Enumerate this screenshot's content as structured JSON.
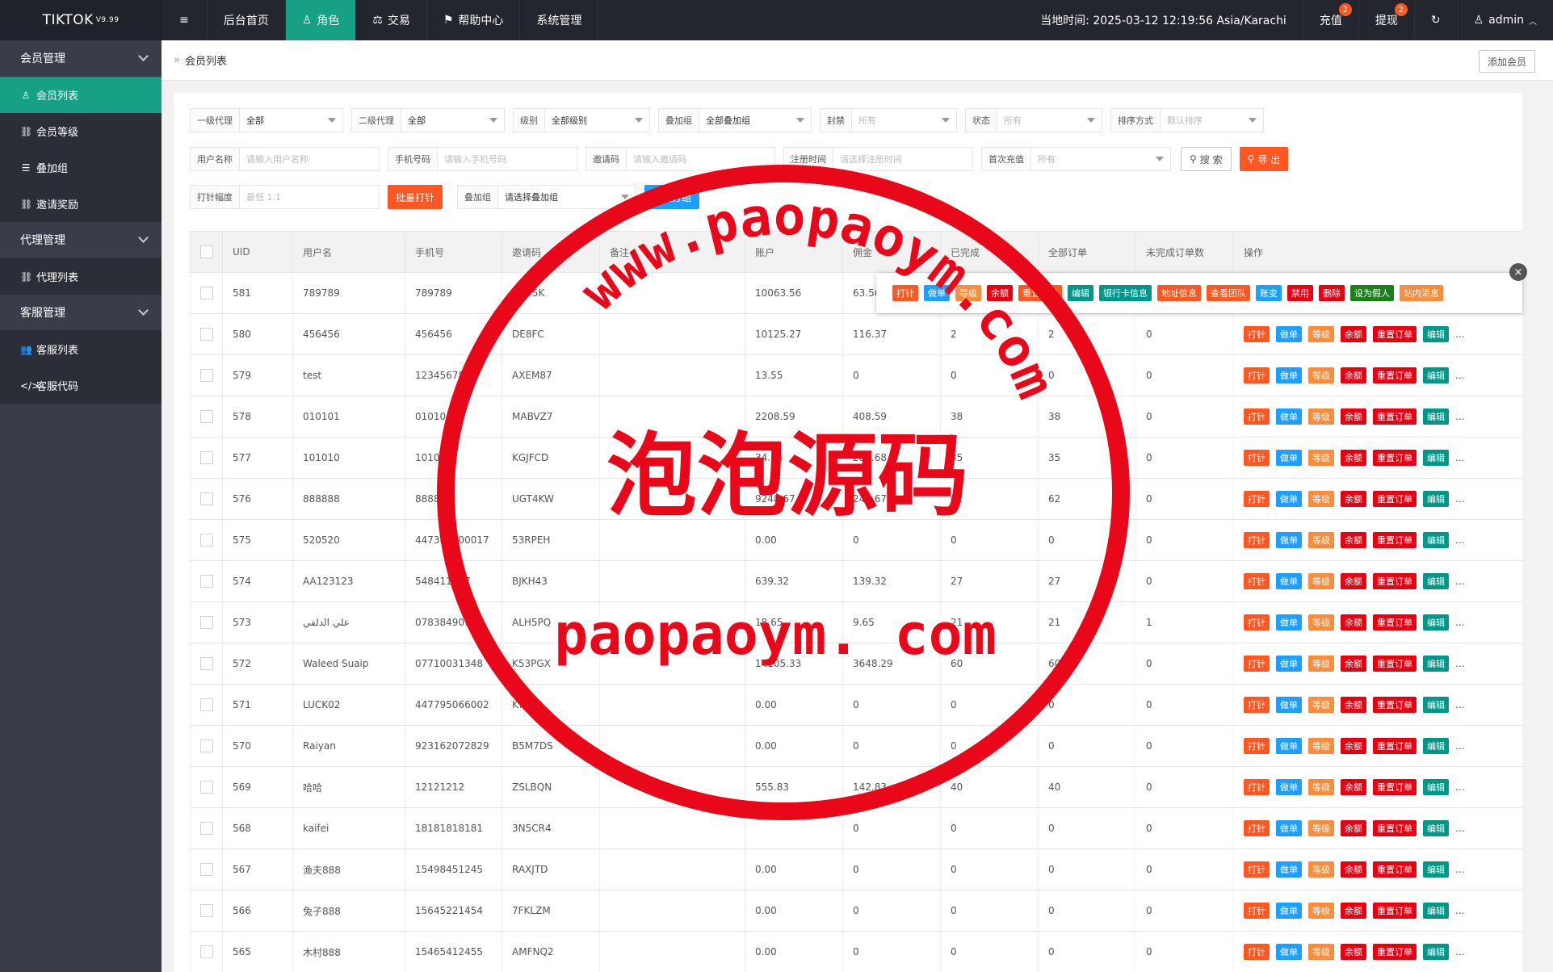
{
  "app": {
    "title": "TIKTOK",
    "version": "V9.99"
  },
  "sidebar": {
    "groups": [
      {
        "label": "会员管理",
        "items": [
          {
            "label": "会员列表",
            "icon": "user-icon",
            "active": true
          },
          {
            "label": "会员等级",
            "icon": "link-icon"
          },
          {
            "label": "叠加组",
            "icon": "list-icon"
          },
          {
            "label": "邀请奖励",
            "icon": "link-icon"
          }
        ]
      },
      {
        "label": "代理管理",
        "items": [
          {
            "label": "代理列表",
            "icon": "link-icon"
          }
        ]
      },
      {
        "label": "客服管理",
        "items": [
          {
            "label": "客服列表",
            "icon": "users-icon"
          },
          {
            "label": "客服代码",
            "icon": "code-icon"
          }
        ]
      }
    ]
  },
  "topbar": {
    "menu_icon": "≡",
    "tabs": [
      "后台首页",
      "角色",
      "交易",
      "帮助中心",
      "系统管理"
    ],
    "time": "当地时间: 2025-03-12 12:19:56  Asia/Karachi",
    "recharge": "充值",
    "recharge_badge": "2",
    "withdraw": "提现",
    "withdraw_badge": "2",
    "user": "admin"
  },
  "breadcrumb": {
    "current": "会员列表",
    "add_button": "添加会员"
  },
  "filters": {
    "row1": [
      {
        "label": "一级代理",
        "value": "全部",
        "placeholder": false
      },
      {
        "label": "二级代理",
        "value": "全部",
        "placeholder": false
      },
      {
        "label": "级别",
        "value": "全部级别",
        "placeholder": false
      },
      {
        "label": "叠加组",
        "value": "全部叠加组",
        "placeholder": false
      },
      {
        "label": "封禁",
        "value": "所有",
        "placeholder": true
      },
      {
        "label": "状态",
        "value": "所有",
        "placeholder": true
      },
      {
        "label": "排序方式",
        "value": "默认排序",
        "placeholder": true
      }
    ],
    "row2": [
      {
        "label": "用户名称",
        "value": "请输入用户名称"
      },
      {
        "label": "手机号码",
        "value": "请输入手机号码"
      },
      {
        "label": "邀请码",
        "value": "请输入邀请码"
      },
      {
        "label": "注册时间",
        "value": "请选择注册时间"
      },
      {
        "label": "首次充值",
        "value": "所有"
      }
    ],
    "search_button": "搜 索",
    "export_button": "导 出",
    "hit_range_label": "打针幅度",
    "hit_range_placeholder": "最低 1.1",
    "batch_hit_button": "批量打针",
    "group_label": "叠加组",
    "group_value": "请选择叠加组",
    "batch_group_button": "批量分组"
  },
  "table": {
    "headers": [
      "UID",
      "用户名",
      "手机号",
      "邀请码",
      "备注",
      "账户",
      "佣金",
      "已完成",
      "全部订单",
      "未完成订单数",
      "操作"
    ],
    "rows": [
      [
        "581",
        "789789",
        "789789",
        "VGP5K",
        "",
        "10063.56",
        "63.56",
        "",
        "",
        ""
      ],
      [
        "580",
        "456456",
        "456456",
        "DE8FC",
        "",
        "10125.27",
        "116.37",
        "2",
        "2",
        "0"
      ],
      [
        "579",
        "test",
        "12345678",
        "AXEM87",
        "",
        "13.55",
        "0",
        "0",
        "0",
        "0"
      ],
      [
        "578",
        "010101",
        "010101",
        "MABVZ7",
        "",
        "2208.59",
        "408.59",
        "38",
        "38",
        "0"
      ],
      [
        "577",
        "101010",
        "101010",
        "KGJFCD",
        "",
        "34.56",
        "283.68",
        "35",
        "35",
        "0"
      ],
      [
        "576",
        "888888",
        "888888",
        "UGT4KW",
        "",
        "9248.67",
        "248.67",
        "62",
        "62",
        "0"
      ],
      [
        "575",
        "520520",
        "447386800017",
        "53RPEH",
        "",
        "0.00",
        "0",
        "0",
        "0",
        "0"
      ],
      [
        "574",
        "AA123123",
        "548411517",
        "BJKH43",
        "",
        "639.32",
        "139.32",
        "27",
        "27",
        "0"
      ],
      [
        "573",
        "علي الدلفي",
        "07838490902",
        "ALH5PQ",
        "",
        "18.65",
        "9.65",
        "21",
        "21",
        "1"
      ],
      [
        "572",
        "Waleed Suaip",
        "07710031348",
        "K53PGX",
        "",
        "14105.33",
        "3648.29",
        "60",
        "60",
        "0"
      ],
      [
        "571",
        "LUCK02",
        "447795066002",
        "KT5KB",
        "",
        "0.00",
        "0",
        "0",
        "0",
        "0"
      ],
      [
        "570",
        "Raiyan",
        "923162072829",
        "B5M7DS",
        "",
        "0.00",
        "0",
        "0",
        "0",
        "0"
      ],
      [
        "569",
        "哈哈",
        "12121212",
        "ZSLBQN",
        "",
        "555.83",
        "142.83",
        "40",
        "40",
        "0"
      ],
      [
        "568",
        "kaifei",
        "18181818181",
        "3N5CR4",
        "",
        "",
        "0",
        "0",
        "0",
        "0"
      ],
      [
        "567",
        "渔夫888",
        "15498451245",
        "RAXJTD",
        "",
        "0.00",
        "0",
        "0",
        "0",
        "0"
      ],
      [
        "566",
        "兔子888",
        "15645221454",
        "7FKLZM",
        "",
        "0.00",
        "0",
        "0",
        "0",
        "0"
      ],
      [
        "565",
        "木村888",
        "15465412455",
        "AMFNQ2",
        "",
        "0.00",
        "0",
        "0",
        "0",
        "0"
      ]
    ],
    "row_actions": [
      "打针",
      "做单",
      "等级",
      "余额",
      "重置订单",
      "编辑"
    ],
    "more": "..."
  },
  "popup": {
    "actions": [
      "打针",
      "做单",
      "等级",
      "余额",
      "重置订单",
      "编辑",
      "银行卡信息",
      "地址信息",
      "查看团队",
      "账变",
      "禁用",
      "删除",
      "设为假人",
      "站内消息"
    ],
    "close": "×"
  },
  "watermark": {
    "url_top": "www.paopaoym.com",
    "center": "泡泡源码",
    "bottom": "paopaoym. com"
  }
}
